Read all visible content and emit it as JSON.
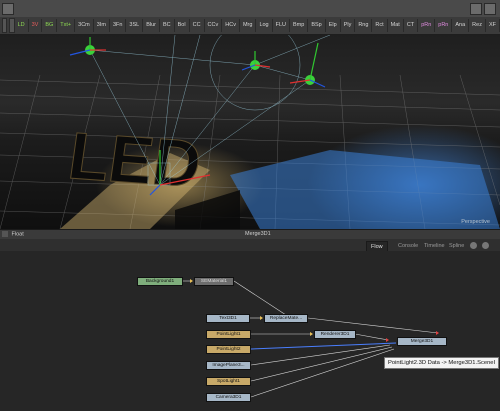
{
  "toolbar": {
    "items": [
      {
        "label": "LD",
        "color": "green"
      },
      {
        "label": "3V",
        "color": "red"
      },
      {
        "label": "BG",
        "color": "green"
      },
      {
        "label": "Txt+",
        "color": "green"
      },
      {
        "label": "3Cm",
        "color": "normal"
      },
      {
        "label": "3Im",
        "color": "normal"
      },
      {
        "label": "3Fn",
        "color": "normal"
      },
      {
        "label": "3SL",
        "color": "normal"
      },
      {
        "label": "Blur",
        "color": "normal"
      },
      {
        "label": "BC",
        "color": "normal"
      },
      {
        "label": "Bol",
        "color": "normal"
      },
      {
        "label": "CC",
        "color": "normal"
      },
      {
        "label": "CCv",
        "color": "normal"
      },
      {
        "label": "HCv",
        "color": "normal"
      },
      {
        "label": "Mrg",
        "color": "normal"
      },
      {
        "label": "Log",
        "color": "normal"
      },
      {
        "label": "FLU",
        "color": "normal"
      },
      {
        "label": "Bmp",
        "color": "normal"
      },
      {
        "label": "BSp",
        "color": "normal"
      },
      {
        "label": "Elp",
        "color": "normal"
      },
      {
        "label": "Ply",
        "color": "normal"
      },
      {
        "label": "Rng",
        "color": "normal"
      },
      {
        "label": "Rct",
        "color": "normal"
      },
      {
        "label": "Mat",
        "color": "normal"
      },
      {
        "label": "CT",
        "color": "normal"
      },
      {
        "label": "pRn",
        "color": "pink"
      },
      {
        "label": "pRn",
        "color": "pink"
      },
      {
        "label": "Ana",
        "color": "normal"
      },
      {
        "label": "Rez",
        "color": "normal"
      },
      {
        "label": "XF",
        "color": "normal"
      }
    ]
  },
  "viewport": {
    "scene_text": "LED",
    "view_label": "Perspective"
  },
  "panel_header": {
    "left_label": "Float",
    "center_label": "Merge3D1"
  },
  "tabs": {
    "flow": "Flow",
    "console": "Console",
    "timeline": "Timeline",
    "spline": "Spline"
  },
  "nodes": {
    "background": "Background1",
    "sematerial": "SEMaterial1",
    "text3d": "Text3D1",
    "replacemat": "ReplaceMate...",
    "pointlight1": "PointLight1",
    "pointlight2": "PointLight2",
    "imageplane": "ImagePlane3...",
    "spotlight": "SpotLight1",
    "camera": "Camera3D1",
    "renderer": "Renderer3D1",
    "merge": "Merge3D1"
  },
  "tooltip": "PointLight2.3D Data -> Merge3D1.SceneI",
  "colors": {
    "accent_green": "#8fdc53",
    "accent_red": "#e85c5c",
    "node_yellow": "#c8a968",
    "node_blue": "#8a9db0",
    "node_green": "#7fae7c"
  }
}
